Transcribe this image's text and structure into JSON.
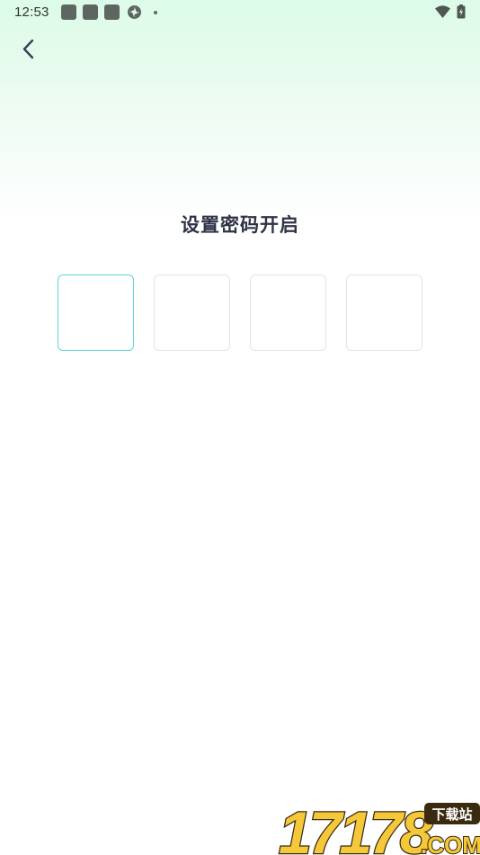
{
  "status_bar": {
    "time": "12:53",
    "notification_icons": [
      "app-notification-icon",
      "app-notification-icon",
      "app-notification-icon",
      "shield-icon",
      "dot-icon"
    ],
    "system_icons": [
      "wifi-icon",
      "battery-charging-icon"
    ]
  },
  "nav": {
    "back_icon": "chevron-left-icon"
  },
  "title": "设置密码开启",
  "pin": {
    "length": 4,
    "boxes": [
      "",
      "",
      "",
      ""
    ],
    "active_index": 0,
    "active_color": "#5fd3df",
    "border_color": "#e2e4e6"
  },
  "watermark": {
    "number": "17178",
    "tag": "下载站",
    "domain": ".COM"
  },
  "colors": {
    "title": "#2f3346",
    "gradient_top": "#dcfbe8"
  }
}
